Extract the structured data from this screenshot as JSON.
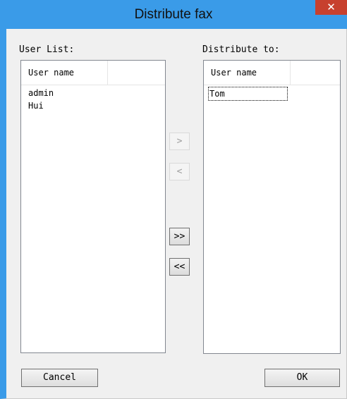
{
  "window": {
    "title": "Distribute fax",
    "close_glyph": "✕"
  },
  "user_list": {
    "label": "User List:",
    "column_header": "User name",
    "items": [
      "admin",
      "Hui"
    ]
  },
  "distribute_to": {
    "label": "Distribute to:",
    "column_header": "User name",
    "items": [
      "Tom"
    ]
  },
  "move_buttons": {
    "add": ">",
    "remove": "<",
    "add_all": ">>",
    "remove_all": "<<"
  },
  "footer": {
    "cancel": "Cancel",
    "ok": "OK"
  },
  "colors": {
    "titlebar": "#3a9be8",
    "close_button": "#c7402e"
  }
}
